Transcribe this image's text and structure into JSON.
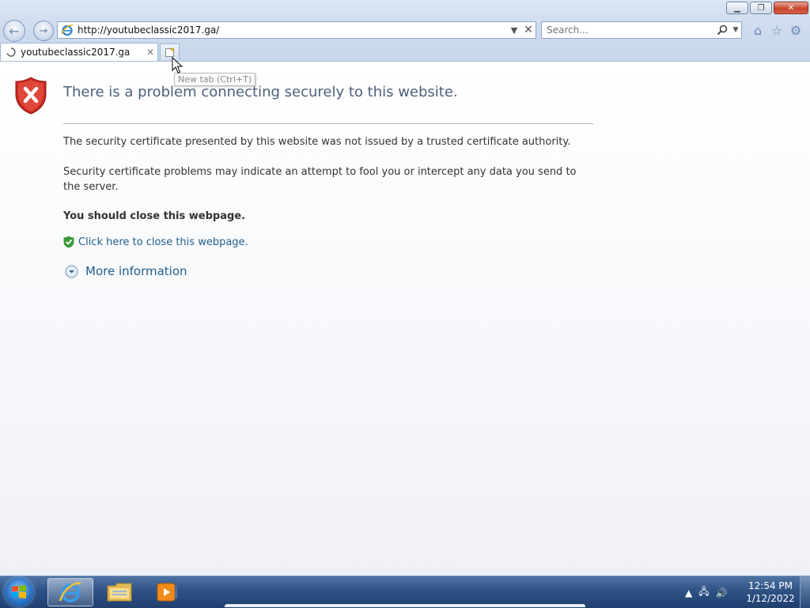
{
  "browser": {
    "address_url": "http://youtubeclassic2017.ga/",
    "search_placeholder": "Search...",
    "tab_title": "youtubeclassic2017.ga",
    "new_tab_tooltip": "New tab (Ctrl+T)",
    "window_buttons": [
      "minimize-icon",
      "restore-icon",
      "close-icon"
    ],
    "toolbar_icons": [
      "home-icon",
      "favorites-star-icon",
      "tools-gear-icon"
    ]
  },
  "page": {
    "title": "There is a problem connecting securely to this website.",
    "paragraph1": "The security certificate presented by this website was not issued by a trusted certificate authority.",
    "paragraph2": "Security certificate problems may indicate an attempt to fool you or intercept any data you send to the server.",
    "recommendation": "You should close this webpage.",
    "close_link": "Click here to close this webpage.",
    "more_info": "More information"
  },
  "taskbar": {
    "items": [
      "start-orb",
      "internet-explorer",
      "windows-explorer",
      "media-player"
    ],
    "time": "12:54 PM",
    "date": "1/12/2022"
  },
  "colors": {
    "title_text": "#4c607a",
    "link": "#1f5e8c",
    "shield_red": "#c8281e"
  }
}
